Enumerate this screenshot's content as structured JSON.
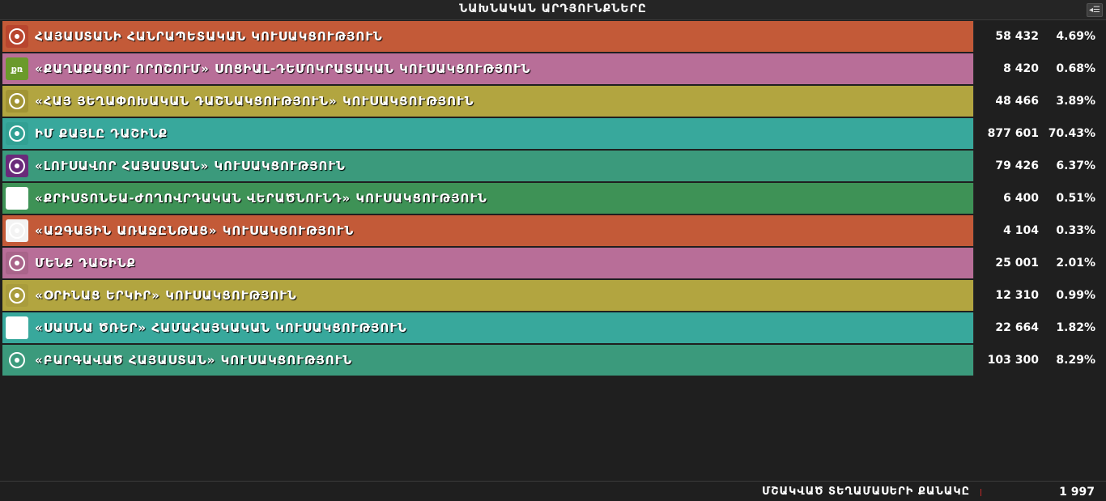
{
  "header": {
    "title": "ՆԱԽՆԱԿԱՆ ԱՐԴՅՈՒՆՔՆԵՐԸ"
  },
  "parties": [
    {
      "name": "ՀԱՅԱՍՏԱՆԻ ՀԱՆՐԱՊԵՏԱԿԱՆ ԿՈՒՍԱԿՑՈՒԹՅՈՒՆ",
      "votes": "58 432",
      "percent": "4.69%",
      "color": "#c35a38",
      "logo_icon": "hhk-logo-icon",
      "logo_bg": "#b8452e"
    },
    {
      "name": "«ՔԱՂԱՔԱՑՈՒ ՈՐՈՇՈՒՄ» ՍՈՑԻԱԼ-ԴԵՄՈԿՐԱՏԱԿԱՆ ԿՈՒՍԱԿՑՈՒԹՅՈՒՆ",
      "votes": "8 420",
      "percent": "0.68%",
      "color": "#b86e98",
      "logo_icon": "qo-logo-icon",
      "logo_bg": "#6b9a2b",
      "logo_text": "քռ"
    },
    {
      "name": "«ՀԱՅ ՅԵՂԱՓՈԽԱԿԱՆ ԴԱՇՆԱԿՑՈՒԹՅՈՒՆ» ԿՈՒՍԱԿՑՈՒԹՅՈՒՆ",
      "votes": "48 466",
      "percent": "3.89%",
      "color": "#b2a540",
      "logo_icon": "arf-logo-icon",
      "logo_bg": "#a19434"
    },
    {
      "name": "ԻՄ ՔԱՅԼԸ ԴԱՇԻՆՔ",
      "votes": "877 601",
      "percent": "70.43%",
      "color": "#38a89c",
      "logo_icon": "my-step-logo-icon",
      "logo_bg": "#31a093"
    },
    {
      "name": "«ԼՈՒՍԱՎՈՐ ՀԱՅԱՍՏԱՆ» ԿՈՒՍԱԿՑՈՒԹՅՈՒՆ",
      "votes": "79 426",
      "percent": "6.37%",
      "color": "#3b9a7c",
      "logo_icon": "bright-armenia-logo-icon",
      "logo_bg": "#6a2a7a"
    },
    {
      "name": "«ՔՐԻՍՏՈՆԵԱ-ԺՈՂՈՎՐԴԱԿԱՆ ՎԵՐԱԾՆՈՒՆԴ» ԿՈՒՍԱԿՑՈՒԹՅՈՒՆ",
      "votes": "6 400",
      "percent": "0.51%",
      "color": "#3e9256",
      "logo_icon": "christian-logo-icon",
      "logo_bg": "#ffffff"
    },
    {
      "name": "«ԱԶԳԱՅԻՆ ԱՌԱՋԸՆԹԱՑ» ԿՈՒՍԱԿՑՈՒԹՅՈՒՆ",
      "votes": "4 104",
      "percent": "0.33%",
      "color": "#c35a38",
      "logo_icon": "national-progress-logo-icon",
      "logo_bg": "#f3f3f3"
    },
    {
      "name": "ՄԵՆՔ ԴԱՇԻՆՔ",
      "votes": "25 001",
      "percent": "2.01%",
      "color": "#b86e98",
      "logo_icon": "we-alliance-logo-icon",
      "logo_bg": "#a9648a"
    },
    {
      "name": "«ՕՐԻՆԱՑ ԵՐԿԻՐ» ԿՈՒՍԱԿՑՈՒԹՅՈՒՆ",
      "votes": "12 310",
      "percent": "0.99%",
      "color": "#b2a540",
      "logo_icon": "rule-of-law-logo-icon",
      "logo_bg": "#a99c3c"
    },
    {
      "name": "«ՍԱՍՆԱ ԾՌԵՐ» ՀԱՄԱՀԱՅԿԱԿԱՆ ԿՈՒՍԱԿՑՈՒԹՅՈՒՆ",
      "votes": "22 664",
      "percent": "1.82%",
      "color": "#38a89c",
      "logo_icon": "sasna-tsrer-logo-icon",
      "logo_bg": "#ffffff"
    },
    {
      "name": "«ԲԱՐԳԱՎԱԾ ՀԱՅԱՍՏԱՆ» ԿՈՒՍԱԿՑՈՒԹՅՈՒՆ",
      "votes": "103 300",
      "percent": "8.29%",
      "color": "#3b9a7c",
      "logo_icon": "prosperous-armenia-logo-icon",
      "logo_bg": "#3b9a7c"
    }
  ],
  "footer": {
    "label": "ՄՇԱԿՎԱԾ ՏԵՂԱՄԱՍԵՐԻ ՔԱՆԱԿԸ",
    "value": "1 997"
  }
}
